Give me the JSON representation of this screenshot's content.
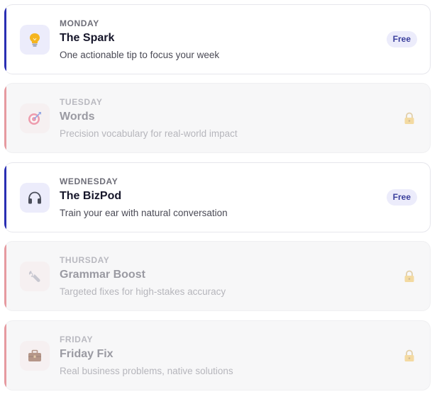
{
  "lessons": [
    {
      "day": "MONDAY",
      "title": "The Spark",
      "description": "One actionable tip to focus your week",
      "badge": "Free",
      "icon": "lightbulb-icon",
      "locked": false
    },
    {
      "day": "TUESDAY",
      "title": "Words",
      "description": "Precision vocabulary for real-world impact",
      "icon": "target-icon",
      "locked": true
    },
    {
      "day": "WEDNESDAY",
      "title": "The BizPod",
      "description": "Train your ear with natural conversation",
      "badge": "Free",
      "icon": "headphones-icon",
      "locked": false
    },
    {
      "day": "THURSDAY",
      "title": "Grammar Boost",
      "description": "Targeted fixes for high-stakes accuracy",
      "icon": "wrench-icon",
      "locked": true
    },
    {
      "day": "FRIDAY",
      "title": "Friday Fix",
      "description": "Real business problems, native solutions",
      "icon": "briefcase-icon",
      "locked": true
    }
  ],
  "colors": {
    "free_accent": "#2a2fb3",
    "locked_accent": "#e69aa0",
    "badge_bg": "#ececfb",
    "badge_text": "#3a3f9c"
  }
}
